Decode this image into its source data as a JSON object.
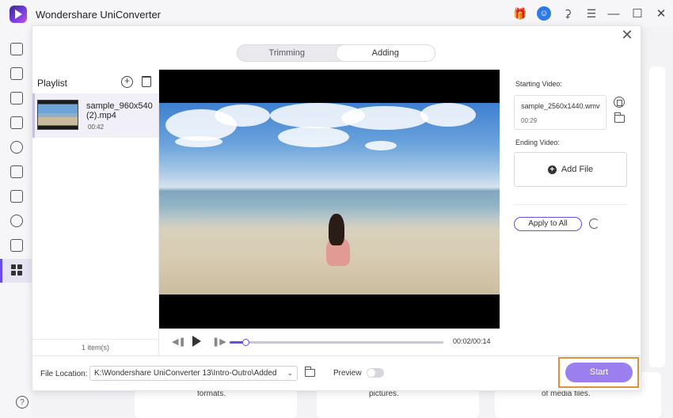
{
  "app": {
    "title": "Wondershare UniConverter"
  },
  "colors": {
    "accent": "#6b4be6",
    "start_button": "#9b7fef",
    "highlight_outline": "#e0903a"
  },
  "titlebar_icons": [
    "gift-icon",
    "user-icon",
    "headset-icon",
    "menu-icon"
  ],
  "window_controls": [
    "minimize",
    "maximize",
    "close"
  ],
  "sidebar_icons": [
    "home-icon",
    "converter-icon",
    "downloader-icon",
    "video-editor-icon",
    "cut-icon",
    "merger-icon",
    "screen-recorder-icon",
    "dvd-burner-icon",
    "player-icon",
    "toolbox-icon"
  ],
  "bottom_icons": [
    "help-icon",
    "notification-icon",
    "feedback-icon"
  ],
  "background": {
    "captions": [
      "formats.",
      "pictures.",
      "of media files."
    ]
  },
  "dialog": {
    "tabs": [
      {
        "label": "Trimming",
        "active": false
      },
      {
        "label": "Adding",
        "active": true
      }
    ]
  },
  "playlist": {
    "title": "Playlist",
    "items": [
      {
        "name": "sample_960x540 (2).mp4",
        "duration": "00:42"
      }
    ],
    "count_label": "1 item(s)"
  },
  "player": {
    "current_time": "00:02",
    "total_time": "00:14",
    "time_label": "00:02/00:14",
    "progress": 0.074
  },
  "right_panel": {
    "starting_label": "Starting Video:",
    "starting_video": {
      "name": "sample_2560x1440.wmv",
      "duration": "00:29"
    },
    "ending_label": "Ending Video:",
    "add_file_label": "Add File",
    "apply_label": "Apply to All"
  },
  "footer": {
    "file_location_label": "File Location:",
    "file_location_value": "K:\\Wondershare UniConverter 13\\Intro-Outro\\Added",
    "preview_label": "Preview",
    "preview_on": false,
    "start_label": "Start"
  }
}
